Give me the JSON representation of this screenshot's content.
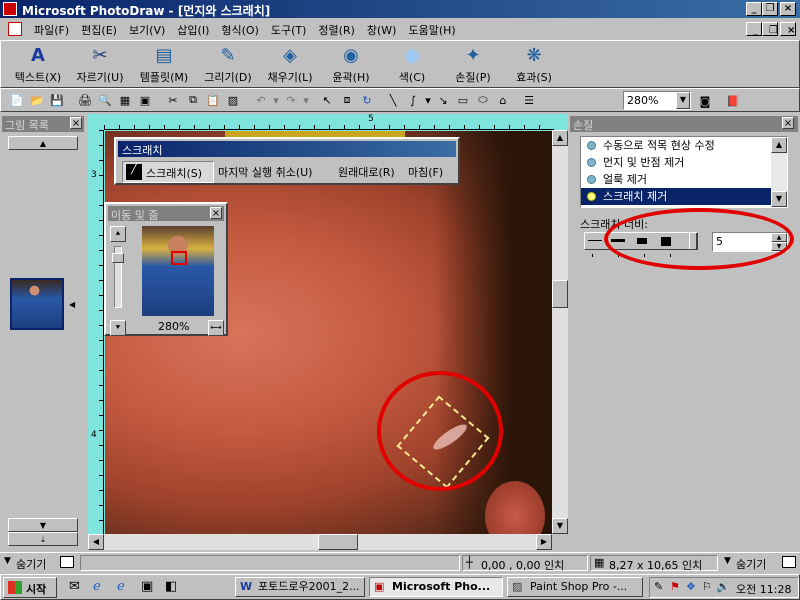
{
  "window": {
    "title": "Microsoft PhotoDraw - [먼지와 스크래치]"
  },
  "menu": [
    "파일(F)",
    "편집(E)",
    "보기(V)",
    "삽입(I)",
    "형식(O)",
    "도구(T)",
    "정렬(R)",
    "창(W)",
    "도움말(H)"
  ],
  "big_toolbar": [
    {
      "label": "텍스트(X)",
      "icon": "text-icon"
    },
    {
      "label": "자르기(U)",
      "icon": "scissors-icon"
    },
    {
      "label": "템플릿(M)",
      "icon": "template-icon"
    },
    {
      "label": "그리기(D)",
      "icon": "brush-icon"
    },
    {
      "label": "채우기(L)",
      "icon": "fill-icon"
    },
    {
      "label": "윤곽(H)",
      "icon": "outline-icon"
    },
    {
      "label": "색(C)",
      "icon": "color-icon"
    },
    {
      "label": "손질(P)",
      "icon": "touchup-icon"
    },
    {
      "label": "효과(S)",
      "icon": "effects-icon"
    }
  ],
  "zoom": "280%",
  "picture_list": {
    "title": "그림 목록"
  },
  "scratch_bar": {
    "title": "스크래치",
    "tool": "스크래치(S)",
    "undo": "마지막 실행 취소(U)",
    "restore": "원래대로(R)",
    "finish": "마침(F)"
  },
  "pan_zoom": {
    "title": "이동 및 줌",
    "zoom": "280%"
  },
  "touchup": {
    "title": "손질",
    "items": [
      "수동으로 적목 현상 수정",
      "먼지 및 반점 제거",
      "얼룩 제거",
      "스크래치 제거"
    ],
    "selected_index": 3,
    "width_label": "스크래치 너비:",
    "width_value": "5"
  },
  "status": {
    "hide_left": "숨기기",
    "position": "0,00 , 0,00 인치",
    "size": "8,27 x 10,65 인치",
    "hide_right": "숨기기"
  },
  "taskbar": {
    "start": "시작",
    "tasks": [
      "포토드로우2001_2...",
      "Microsoft Pho...",
      "Paint Shop Pro -..."
    ],
    "clock": "오전 11:28"
  },
  "ruler_marks": {
    "top_5": "5",
    "left_3": "3",
    "left_4": "4"
  },
  "colors": {
    "highlight_circle": "#e00000",
    "title_bar": "#0a246a",
    "ruler": "#7fe3de"
  }
}
